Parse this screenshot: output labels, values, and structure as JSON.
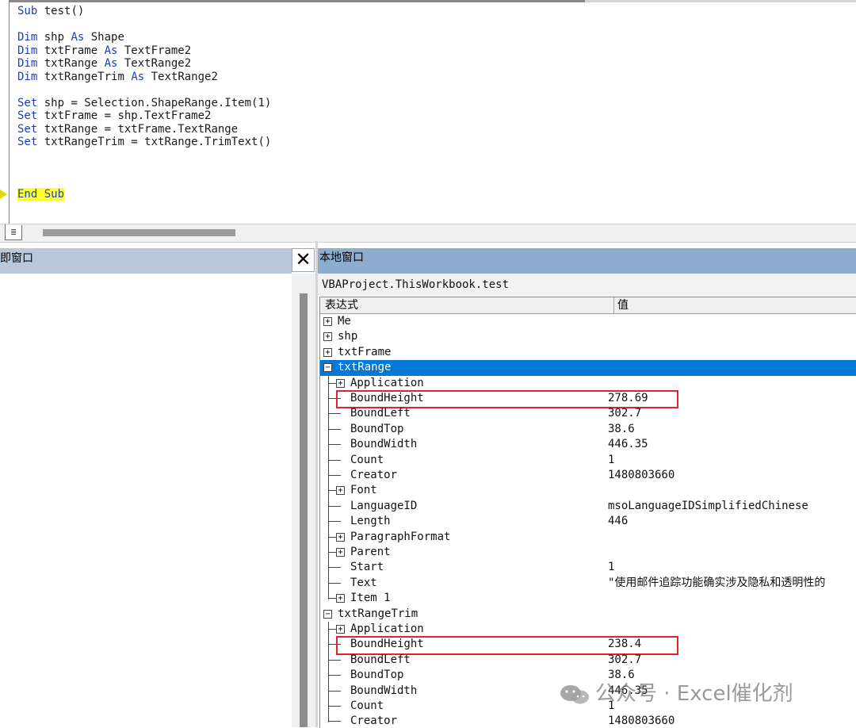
{
  "code": {
    "lines": [
      "Sub test()",
      "",
      "Dim shp As Shape",
      "Dim txtFrame As TextFrame2",
      "Dim txtRange As TextRange2",
      "Dim txtRangeTrim As TextRange2",
      "",
      "Set shp = Selection.ShapeRange.Item(1)",
      "Set txtFrame = shp.TextFrame2",
      "Set txtRange = txtFrame.TextRange",
      "Set txtRangeTrim = txtRange.TrimText()",
      "",
      "",
      "",
      "End Sub"
    ],
    "current_line": 14
  },
  "immediate": {
    "title": "即窗口",
    "close_glyph": "✕"
  },
  "locals": {
    "title": "本地窗口",
    "context": "VBAProject.ThisWorkbook.test",
    "columns": [
      "表达式",
      "值"
    ],
    "rows": [
      {
        "name": "Me",
        "value": "",
        "level": 0,
        "toggle": "+"
      },
      {
        "name": "shp",
        "value": "",
        "level": 0,
        "toggle": "+"
      },
      {
        "name": "txtFrame",
        "value": "",
        "level": 0,
        "toggle": "+"
      },
      {
        "name": "txtRange",
        "value": "",
        "level": 0,
        "toggle": "-",
        "selected": true
      },
      {
        "name": "Application",
        "value": "",
        "level": 1,
        "toggle": "+"
      },
      {
        "name": "BoundHeight",
        "value": "278.69",
        "level": 1,
        "toggle": "",
        "highlight": true
      },
      {
        "name": "BoundLeft",
        "value": "302.7",
        "level": 1,
        "toggle": ""
      },
      {
        "name": "BoundTop",
        "value": "38.6",
        "level": 1,
        "toggle": ""
      },
      {
        "name": "BoundWidth",
        "value": "446.35",
        "level": 1,
        "toggle": ""
      },
      {
        "name": "Count",
        "value": "1",
        "level": 1,
        "toggle": ""
      },
      {
        "name": "Creator",
        "value": "1480803660",
        "level": 1,
        "toggle": ""
      },
      {
        "name": "Font",
        "value": "",
        "level": 1,
        "toggle": "+"
      },
      {
        "name": "LanguageID",
        "value": "msoLanguageIDSimplifiedChinese",
        "level": 1,
        "toggle": ""
      },
      {
        "name": "Length",
        "value": "446",
        "level": 1,
        "toggle": ""
      },
      {
        "name": "ParagraphFormat",
        "value": "",
        "level": 1,
        "toggle": "+"
      },
      {
        "name": "Parent",
        "value": "",
        "level": 1,
        "toggle": "+"
      },
      {
        "name": "Start",
        "value": "1",
        "level": 1,
        "toggle": ""
      },
      {
        "name": "Text",
        "value": "\"使用邮件追踪功能确实涉及隐私和透明性的",
        "level": 1,
        "toggle": ""
      },
      {
        "name": "Item 1",
        "value": "",
        "level": 1,
        "toggle": "+",
        "last": true
      },
      {
        "name": "txtRangeTrim",
        "value": "",
        "level": 0,
        "toggle": "-"
      },
      {
        "name": "Application",
        "value": "",
        "level": 1,
        "toggle": "+"
      },
      {
        "name": "BoundHeight",
        "value": "238.4",
        "level": 1,
        "toggle": "",
        "highlight": true
      },
      {
        "name": "BoundLeft",
        "value": "302.7",
        "level": 1,
        "toggle": ""
      },
      {
        "name": "BoundTop",
        "value": "38.6",
        "level": 1,
        "toggle": ""
      },
      {
        "name": "BoundWidth",
        "value": "446.35",
        "level": 1,
        "toggle": ""
      },
      {
        "name": "Count",
        "value": "1",
        "level": 1,
        "toggle": ""
      },
      {
        "name": "Creator",
        "value": "1480803660",
        "level": 1,
        "toggle": ""
      }
    ]
  },
  "watermark": "公众号 · Excel催化剂",
  "colors": {
    "keyword": "#1f3fb8",
    "current_line_bg": "#ffff2e",
    "selected_row": "#0078d7",
    "highlight_box": "#e0232e",
    "locals_title_bg": "#8eaccd",
    "immediate_title_bg": "#b9c9db"
  }
}
